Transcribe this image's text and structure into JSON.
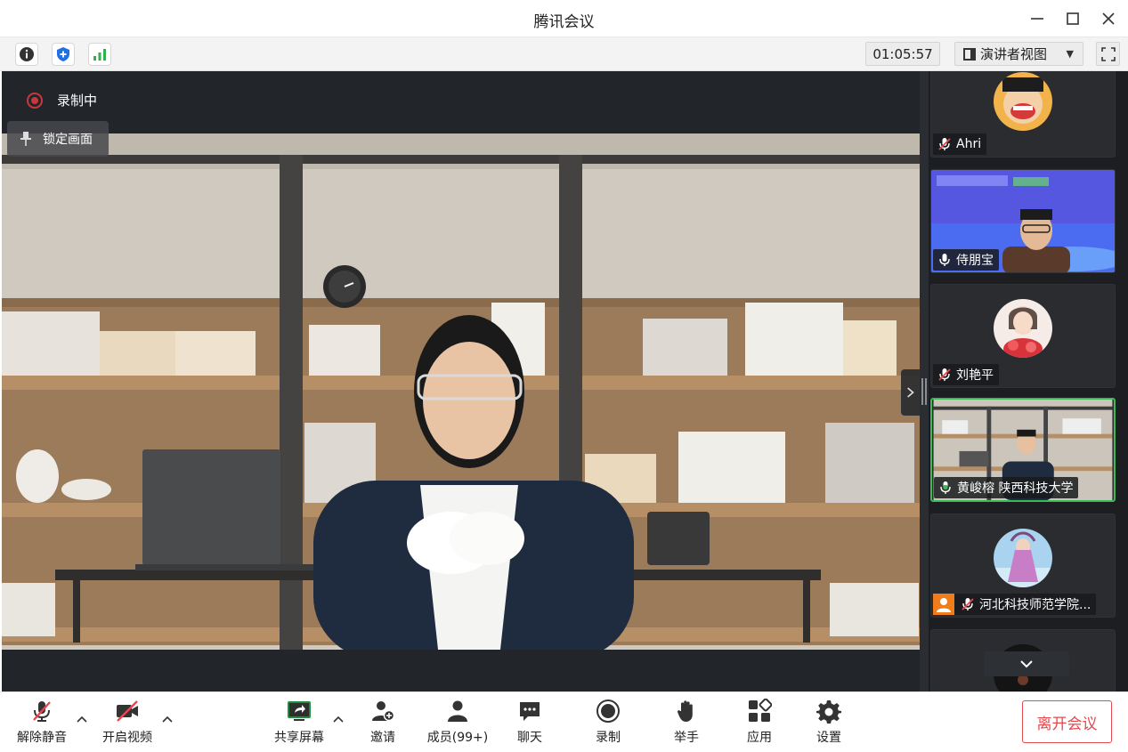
{
  "window": {
    "title": "腾讯会议"
  },
  "infobar": {
    "timer": "01:05:57",
    "view_mode": "演讲者视图"
  },
  "stage": {
    "recording_label": "录制中",
    "pin_label": "锁定画面"
  },
  "participants": [
    {
      "name": "Ahri",
      "mic": "muted"
    },
    {
      "name": "侍朋宝",
      "mic": "on"
    },
    {
      "name": "刘艳平",
      "mic": "muted"
    },
    {
      "name": "黄峻榕 陕西科技大学",
      "mic": "speaking"
    },
    {
      "name": "河北科技师范学院...",
      "mic": "muted"
    }
  ],
  "toolbar": {
    "unmute": "解除静音",
    "start_video": "开启视频",
    "share_screen": "共享屏幕",
    "invite": "邀请",
    "members": "成员(99+)",
    "chat": "聊天",
    "record": "录制",
    "raise_hand": "举手",
    "apps": "应用",
    "settings": "设置",
    "leave": "离开会议"
  },
  "colors": {
    "accent_green": "#3cba56",
    "record_red": "#c8383a",
    "leave_red": "#e5484d",
    "shield_blue": "#1f6fe5"
  }
}
